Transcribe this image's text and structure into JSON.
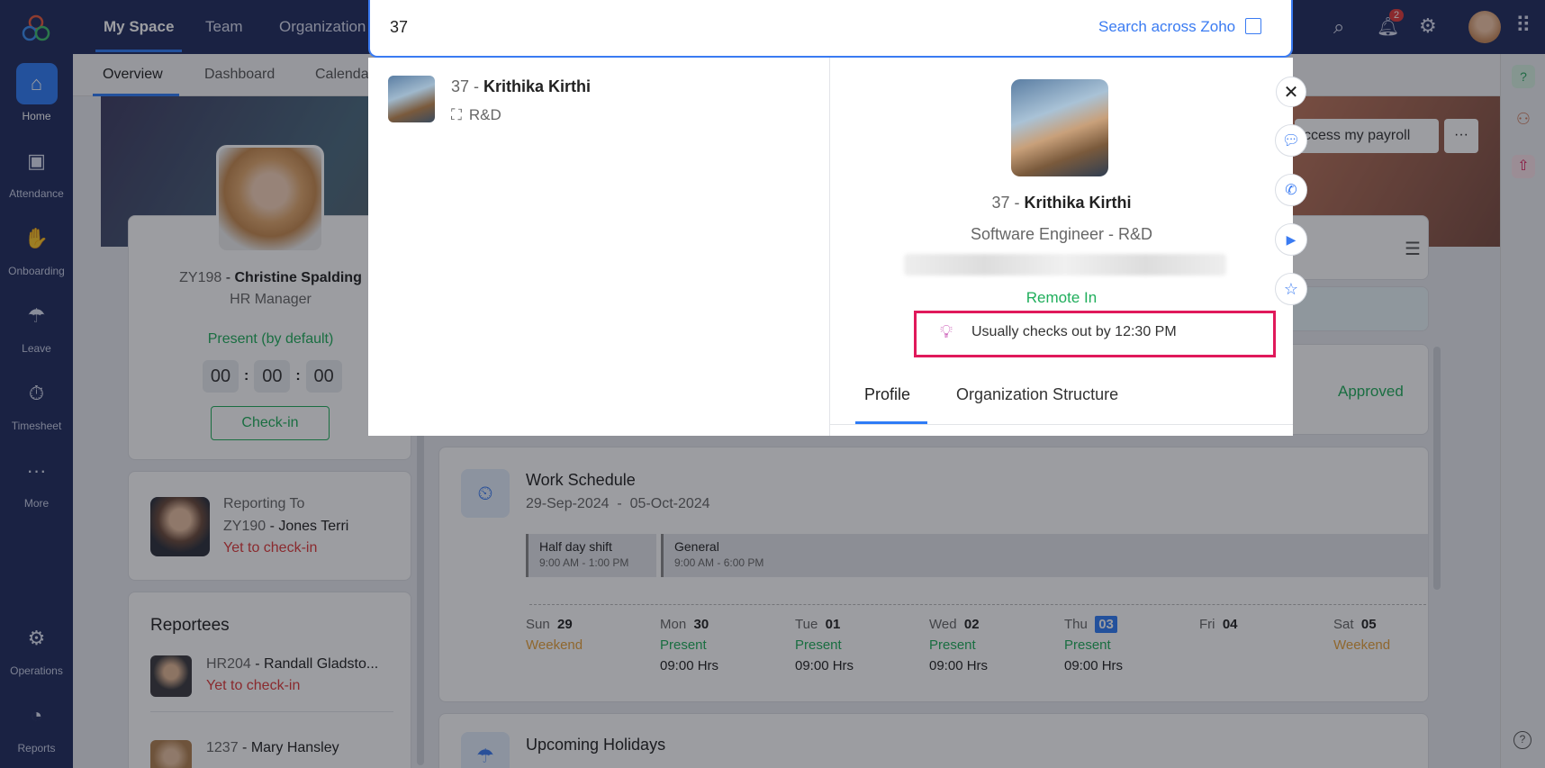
{
  "rail": {
    "items": [
      {
        "label": "Home",
        "icon": "home-icon"
      },
      {
        "label": "Attendance",
        "icon": "attendance-icon"
      },
      {
        "label": "Onboarding",
        "icon": "onboarding-icon"
      },
      {
        "label": "Leave",
        "icon": "leave-icon"
      },
      {
        "label": "Timesheet",
        "icon": "timesheet-icon"
      },
      {
        "label": "More",
        "icon": "more-icon"
      },
      {
        "label": "Operations",
        "icon": "operations-icon"
      },
      {
        "label": "Reports",
        "icon": "reports-icon"
      }
    ]
  },
  "topbar": {
    "tabs": [
      "My Space",
      "Team",
      "Organization"
    ],
    "notification_count": "2"
  },
  "subnav": {
    "tabs": [
      "Overview",
      "Dashboard",
      "Calendar"
    ]
  },
  "profile": {
    "id": "ZY198",
    "name": "Christine Spalding",
    "role": "HR Manager",
    "status": "Present (by default)",
    "timer": [
      "00",
      "00",
      "00"
    ],
    "checkin_label": "Check-in"
  },
  "reporting": {
    "title": "Reporting To",
    "id": "ZY190",
    "name": "Jones Terri",
    "status": "Yet to check-in"
  },
  "reportees": {
    "title": "Reportees",
    "items": [
      {
        "id": "HR204",
        "name": "Randall Gladsto...",
        "status": "Yet to check-in"
      },
      {
        "id": "1237",
        "name": "Mary Hansley"
      }
    ]
  },
  "banner": {
    "payroll_label": "ccess my payroll",
    "more_label": "···"
  },
  "approved_label": "Approved",
  "work_schedule": {
    "title": "Work Schedule",
    "range_start": "29-Sep-2024",
    "range_sep": "-",
    "range_end": "05-Oct-2024",
    "shifts": [
      {
        "name": "Half day shift",
        "time": "9:00 AM - 1:00 PM"
      },
      {
        "name": "General",
        "time": "9:00 AM - 6:00 PM"
      }
    ],
    "days": [
      {
        "dow": "Sun",
        "date": "29",
        "status": "Weekend",
        "hours": ""
      },
      {
        "dow": "Mon",
        "date": "30",
        "status": "Present",
        "hours": "09:00 Hrs"
      },
      {
        "dow": "Tue",
        "date": "01",
        "status": "Present",
        "hours": "09:00 Hrs"
      },
      {
        "dow": "Wed",
        "date": "02",
        "status": "Present",
        "hours": "09:00 Hrs"
      },
      {
        "dow": "Thu",
        "date": "03",
        "status": "Present",
        "hours": "09:00 Hrs"
      },
      {
        "dow": "Fri",
        "date": "04",
        "status": "",
        "hours": ""
      },
      {
        "dow": "Sat",
        "date": "05",
        "status": "Weekend",
        "hours": ""
      }
    ]
  },
  "holidays": {
    "title": "Upcoming Holidays"
  },
  "search": {
    "query": "37",
    "across_label": "Search across Zoho",
    "result": {
      "id": "37",
      "sep": " - ",
      "name": "Krithika Kirthi",
      "dept": "R&D"
    },
    "detail": {
      "id": "37",
      "sep": " - ",
      "name": "Krithika Kirthi",
      "title": "Software Engineer - R&D",
      "presence": "Remote In",
      "insight": "Usually checks out by 12:30 PM",
      "tabs": [
        "Profile",
        "Organization Structure"
      ]
    }
  },
  "colors": {
    "navy": "#1f2b5e",
    "accent": "#2f7cf6",
    "green": "#1fae5b",
    "red": "#e03a3a",
    "orange": "#e8a23a",
    "highlight": "#e0195b"
  }
}
